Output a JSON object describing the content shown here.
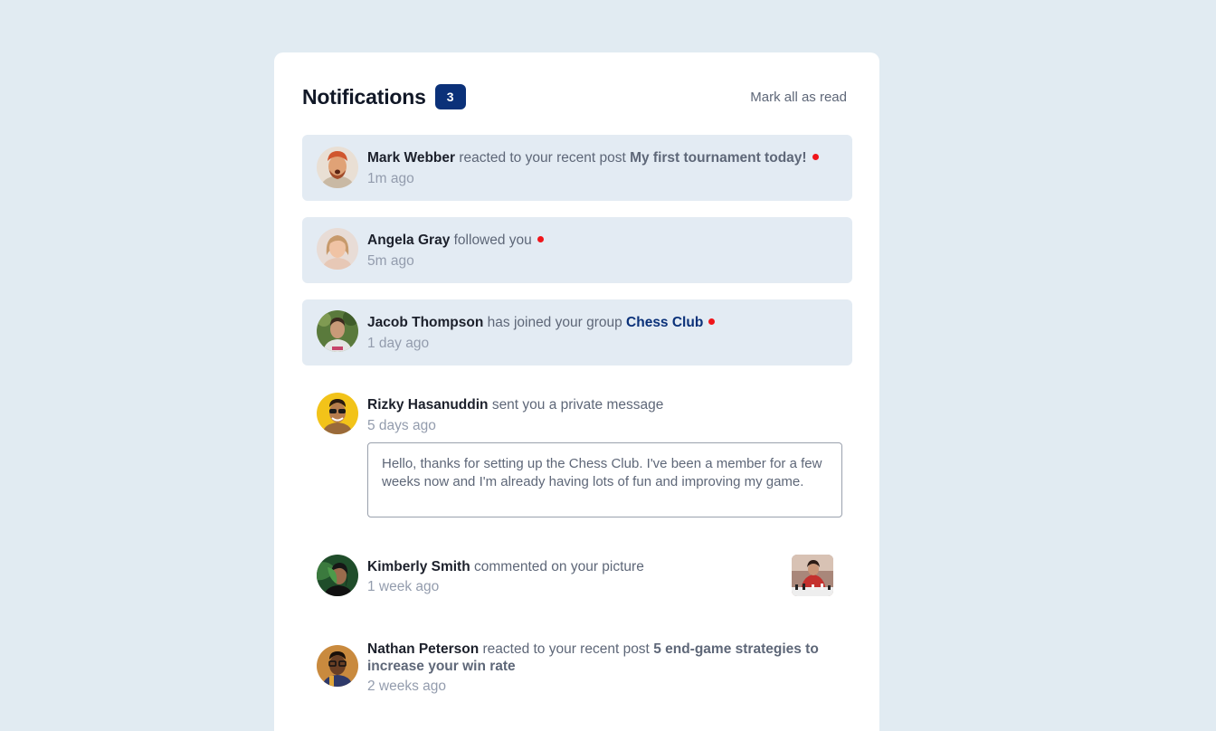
{
  "header": {
    "title": "Notifications",
    "unread_count": "3",
    "mark_all_label": "Mark all as read"
  },
  "notifications": [
    {
      "name": "Mark Webber",
      "action": "reacted to your recent post",
      "post": "My first tournament today!",
      "time": "1m ago",
      "unread": true
    },
    {
      "name": "Angela Gray",
      "action": "followed you",
      "time": "5m ago",
      "unread": true
    },
    {
      "name": "Jacob Thompson",
      "action": "has joined your group",
      "group": "Chess Club",
      "time": "1 day ago",
      "unread": true
    },
    {
      "name": "Rizky Hasanuddin",
      "action": "sent you a private message",
      "time": "5 days ago",
      "message": "Hello, thanks for setting up the Chess Club. I've been a member for a few weeks now and I'm already having lots of fun and improving my game.",
      "unread": false
    },
    {
      "name": "Kimberly Smith",
      "action": "commented on your picture",
      "time": "1 week ago",
      "unread": false
    },
    {
      "name": "Nathan Peterson",
      "action": "reacted to your recent post",
      "post": "5 end-game strategies to increase your win rate",
      "time": "2 weeks ago",
      "unread": false
    }
  ],
  "colors": {
    "page_bg": "#e1ebf2",
    "card_bg": "#ffffff",
    "unread_bg": "#e3ebf3",
    "badge": "#0b3179",
    "dot": "#f0151a",
    "name": "#1c202b",
    "body_text": "#5e6778",
    "time_text": "#939cad"
  }
}
